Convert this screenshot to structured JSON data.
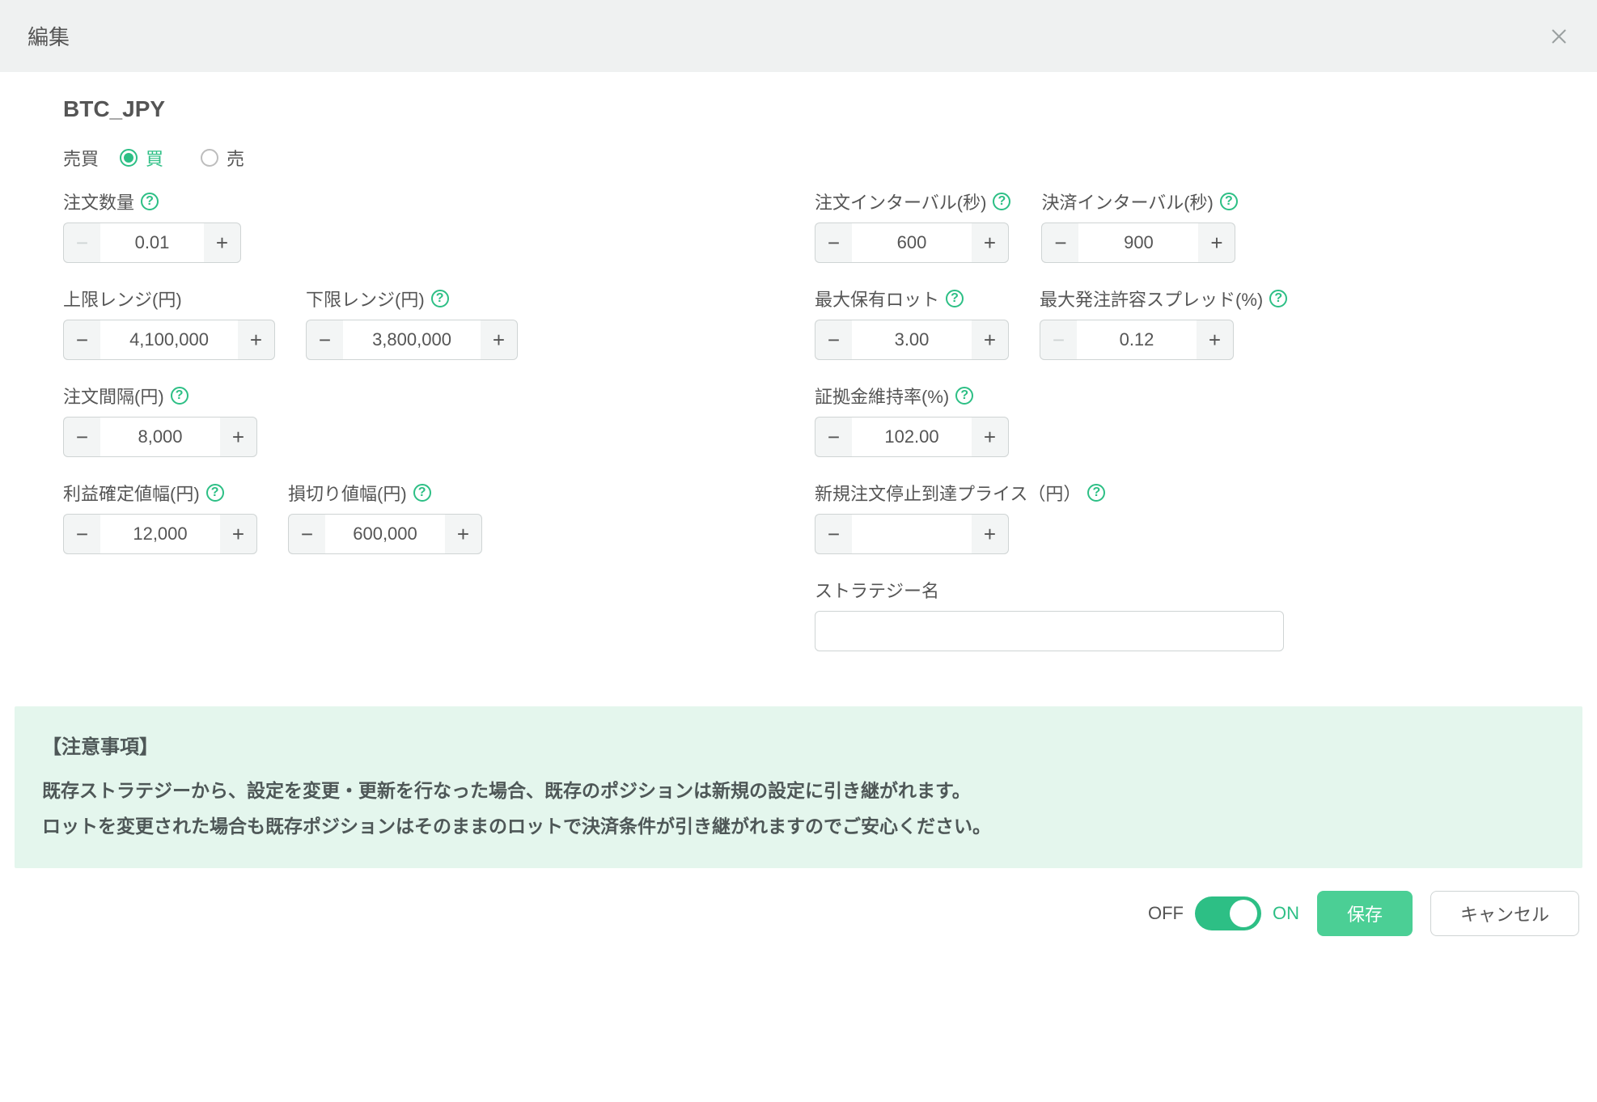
{
  "header": {
    "title": "編集"
  },
  "symbol": "BTC_JPY",
  "buysell": {
    "label": "売買",
    "buy_label": "買",
    "sell_label": "売",
    "selected": "buy"
  },
  "fields": {
    "order_qty": {
      "label": "注文数量",
      "value": "0.01",
      "help": true,
      "minus_disabled": true
    },
    "upper_range": {
      "label": "上限レンジ(円)",
      "value": "4,100,000",
      "help": false
    },
    "lower_range": {
      "label": "下限レンジ(円)",
      "value": "3,800,000",
      "help": true
    },
    "order_gap": {
      "label": "注文間隔(円)",
      "value": "8,000",
      "help": true
    },
    "tp_width": {
      "label": "利益確定値幅(円)",
      "value": "12,000",
      "help": true
    },
    "sl_width": {
      "label": "損切り値幅(円)",
      "value": "600,000",
      "help": true
    },
    "order_interval": {
      "label": "注文インターバル(秒)",
      "value": "600",
      "help": true
    },
    "settle_interval": {
      "label": "決済インターバル(秒)",
      "value": "900",
      "help": true
    },
    "max_lots": {
      "label": "最大保有ロット",
      "value": "3.00",
      "help": true
    },
    "max_spread": {
      "label": "最大発注許容スプレッド(%)",
      "value": "0.12",
      "help": true,
      "minus_disabled": true
    },
    "margin_ratio": {
      "label": "証拠金維持率(%)",
      "value": "102.00",
      "help": true
    },
    "stop_price": {
      "label": "新規注文停止到達プライス（円）",
      "value": "",
      "help": true
    },
    "strategy_name": {
      "label": "ストラテジー名",
      "value": ""
    }
  },
  "notice": {
    "title": "【注意事項】",
    "line1": "既存ストラテジーから、設定を変更・更新を行なった場合、既存のポジションは新規の設定に引き継がれます。",
    "line2": "ロットを変更された場合も既存ポジションはそのままのロットで決済条件が引き継がれますのでご安心ください。"
  },
  "footer": {
    "off": "OFF",
    "on": "ON",
    "toggle_state": "on",
    "save": "保存",
    "cancel": "キャンセル"
  }
}
